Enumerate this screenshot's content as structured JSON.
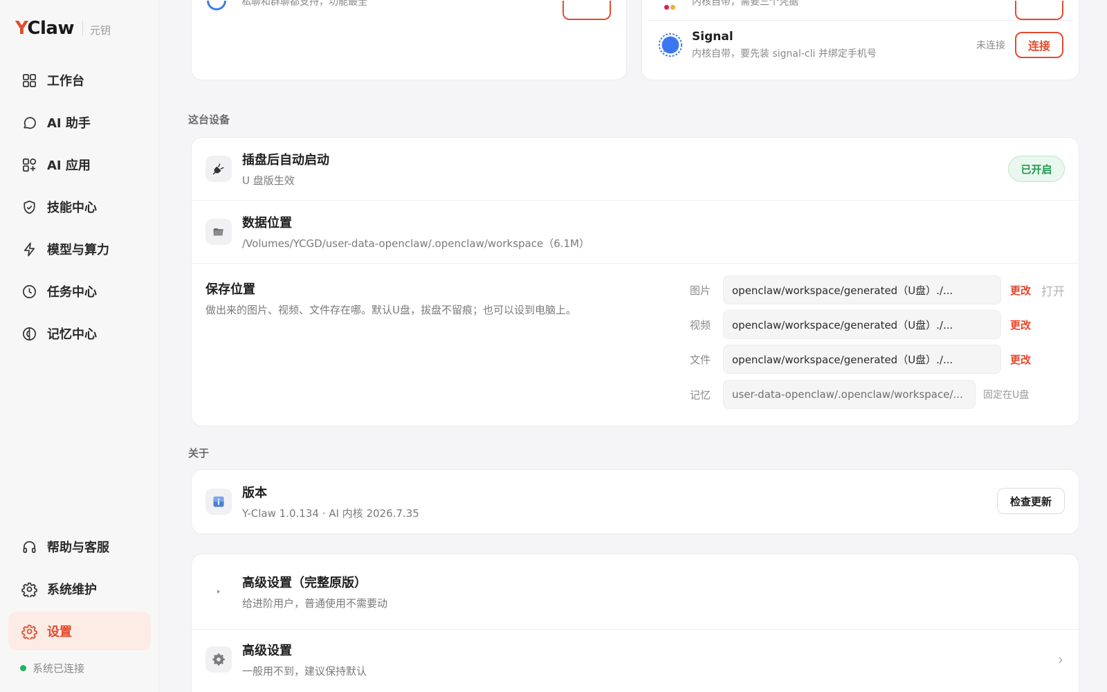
{
  "brand": {
    "logo_y": "Y",
    "logo_rest": "Claw",
    "subtitle": "元钥"
  },
  "sidebar": {
    "items": [
      {
        "label": "工作台",
        "icon": "grid-icon"
      },
      {
        "label": "AI 助手",
        "icon": "chat-bubble-icon"
      },
      {
        "label": "AI 应用",
        "icon": "apps-icon"
      },
      {
        "label": "技能中心",
        "icon": "shield-check-icon"
      },
      {
        "label": "模型与算力",
        "icon": "lightning-icon"
      },
      {
        "label": "任务中心",
        "icon": "clock-icon"
      },
      {
        "label": "记忆中心",
        "icon": "memory-icon"
      }
    ],
    "bottom_items": [
      {
        "label": "帮助与客服",
        "icon": "headphones-icon"
      },
      {
        "label": "系统维护",
        "icon": "gear-icon"
      },
      {
        "label": "设置",
        "icon": "settings-icon",
        "active": true
      }
    ],
    "status": "系统已连接",
    "accent": "#e5492c",
    "status_color": "#22b35e"
  },
  "channels": {
    "left_partial_desc": "私聊和群聊都支持，功能最全",
    "right_partial_desc": "内核自带，需要三个凭据",
    "signal": {
      "name": "Signal",
      "desc": "内核自带，要先装 signal-cli 并绑定手机号",
      "status": "未连接",
      "connect_label": "连接"
    }
  },
  "device": {
    "section_label": "这台设备",
    "autostart": {
      "title": "插盘后自动启动",
      "sub": "U 盘版生效",
      "badge": "已开启"
    },
    "data_location": {
      "title": "数据位置",
      "path": "/Volumes/YCGD/user-data-openclaw/.openclaw/workspace（6.1M）"
    },
    "save_location": {
      "title": "保存位置",
      "desc": "做出来的图片、视频、文件存在哪。默认U盘，拔盘不留痕；也可以设到电脑上。",
      "rows": [
        {
          "label": "图片",
          "path": "openclaw/workspace/generated（U盘）./...",
          "change": "更改",
          "open": "打开"
        },
        {
          "label": "视频",
          "path": "openclaw/workspace/generated（U盘）./...",
          "change": "更改"
        },
        {
          "label": "文件",
          "path": "openclaw/workspace/generated（U盘）./...",
          "change": "更改"
        },
        {
          "label": "记忆",
          "path": "user-data-openclaw/.openclaw/workspace/...",
          "note": "固定在U盘"
        }
      ]
    }
  },
  "about": {
    "section_label": "关于",
    "title": "版本",
    "version": "Y-Claw 1.0.134 · AI 内核 2026.7.35",
    "check_update": "检查更新"
  },
  "advanced": {
    "full": {
      "title": "高级设置（完整原版）",
      "sub": "给进阶用户，普通使用不需要动"
    },
    "normal": {
      "title": "高级设置",
      "sub": "一般用不到，建议保持默认"
    }
  }
}
